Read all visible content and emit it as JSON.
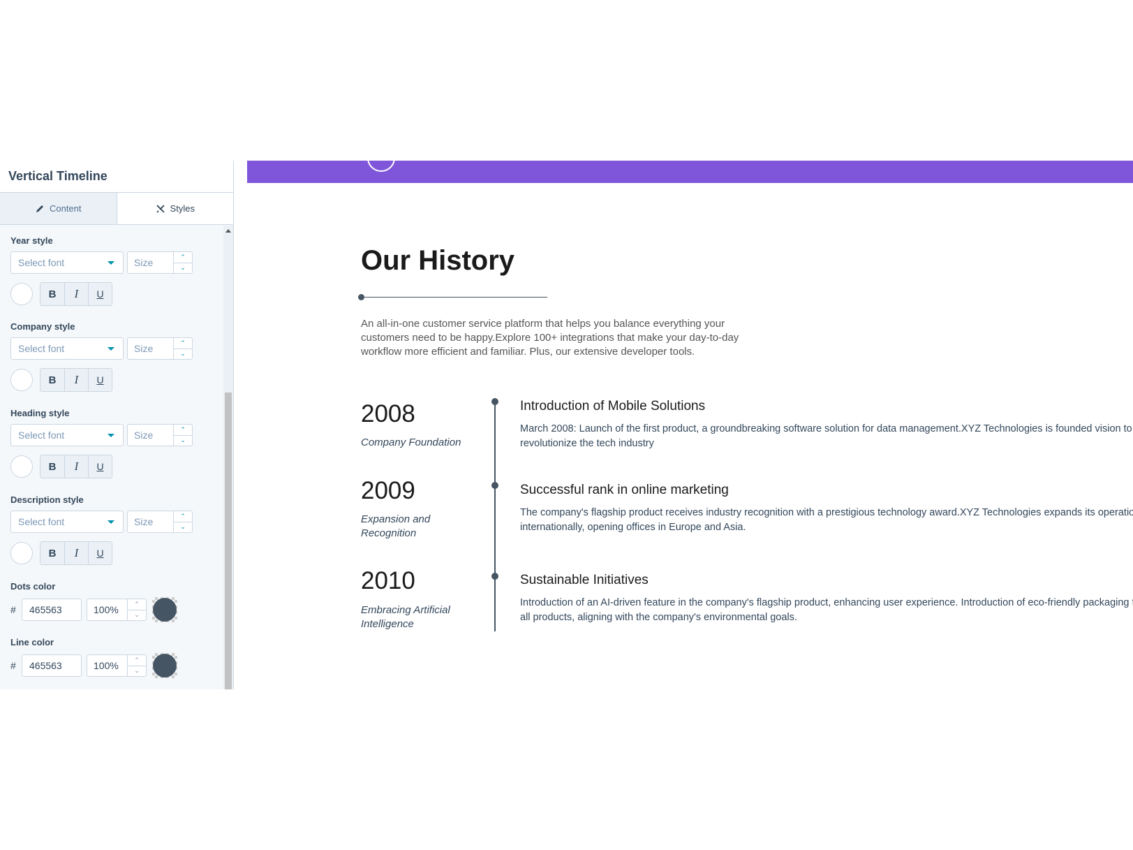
{
  "panel": {
    "title": "Vertical Timeline",
    "tabs": [
      {
        "label": "Content",
        "icon": "pencil-icon",
        "active": false
      },
      {
        "label": "Styles",
        "icon": "styles-icon",
        "active": true
      }
    ],
    "groups": [
      {
        "label": "Year style",
        "font_placeholder": "Select font",
        "size_placeholder": "Size"
      },
      {
        "label": "Company style",
        "font_placeholder": "Select font",
        "size_placeholder": "Size"
      },
      {
        "label": "Heading style",
        "font_placeholder": "Select font",
        "size_placeholder": "Size"
      },
      {
        "label": "Description style",
        "font_placeholder": "Select font",
        "size_placeholder": "Size"
      }
    ],
    "format_buttons": {
      "bold": "B",
      "italic": "I",
      "underline": "U"
    },
    "dots_color": {
      "label": "Dots color",
      "hash": "#",
      "hex": "465563",
      "opacity": "100%",
      "swatch": "#465563"
    },
    "line_color": {
      "label": "Line color",
      "hash": "#",
      "hex": "465563",
      "opacity": "100%",
      "swatch": "#465563"
    }
  },
  "preview": {
    "banner_color": "#7f56d9",
    "title": "Our History",
    "intro": "An all-in-one customer service platform that helps you balance everything your customers need to be happy.Explore 100+ integrations that make your day-to-day workflow more efficient and familiar. Plus, our extensive developer tools.",
    "timeline_color": "#465563",
    "items": [
      {
        "year": "2008",
        "company": "Company Foundation",
        "heading": "Introduction of Mobile Solutions",
        "description": "March 2008: Launch of the first product, a groundbreaking software solution for data management.XYZ Technologies is founded vision to revolutionize the tech industry"
      },
      {
        "year": "2009",
        "company": "Expansion and Recognition",
        "heading": "Successful rank in online marketing",
        "description": "The company's flagship product receives industry recognition with a prestigious technology award.XYZ Technologies expands its operations internationally, opening offices in Europe and Asia."
      },
      {
        "year": "2010",
        "company": "Embracing Artificial Intelligence",
        "heading": "Sustainable Initiatives",
        "description": "Introduction of an AI-driven feature in the company's flagship product, enhancing user experience. Introduction of eco-friendly packaging for all products, aligning with the company's environmental goals."
      }
    ]
  }
}
